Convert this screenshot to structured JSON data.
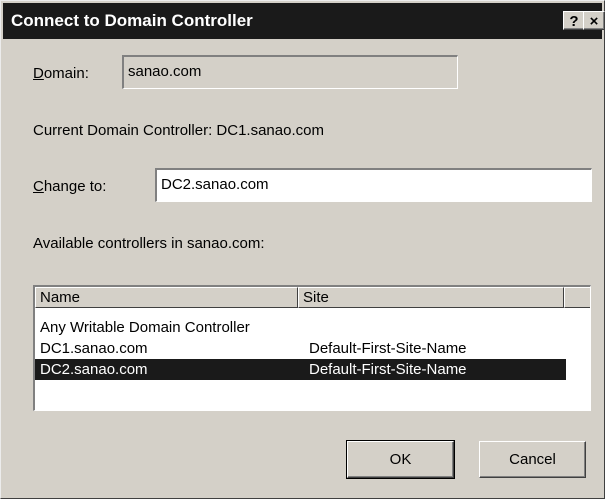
{
  "window": {
    "title": "Connect to Domain Controller",
    "help_button": "?",
    "close_button": "×"
  },
  "domain": {
    "label": "Domain:",
    "value": "sanao.com"
  },
  "current_dc": {
    "text": "Current Domain Controller: DC1.sanao.com"
  },
  "change_to": {
    "label": "Change to:",
    "value": "DC2.sanao.com"
  },
  "available": {
    "label": "Available controllers in sanao.com:",
    "columns": [
      "Name",
      "Site"
    ],
    "rows": [
      {
        "name": "Any Writable Domain Controller",
        "site": ""
      },
      {
        "name": "DC1.sanao.com",
        "site": "Default-First-Site-Name"
      },
      {
        "name": "DC2.sanao.com",
        "site": "Default-First-Site-Name",
        "selected": true
      }
    ]
  },
  "buttons": {
    "ok": "OK",
    "cancel": "Cancel"
  },
  "colors": {
    "titlebar": "#1a1a1a",
    "dialog_bg": "#d4d0c8",
    "selection": "#1a1a1a"
  }
}
